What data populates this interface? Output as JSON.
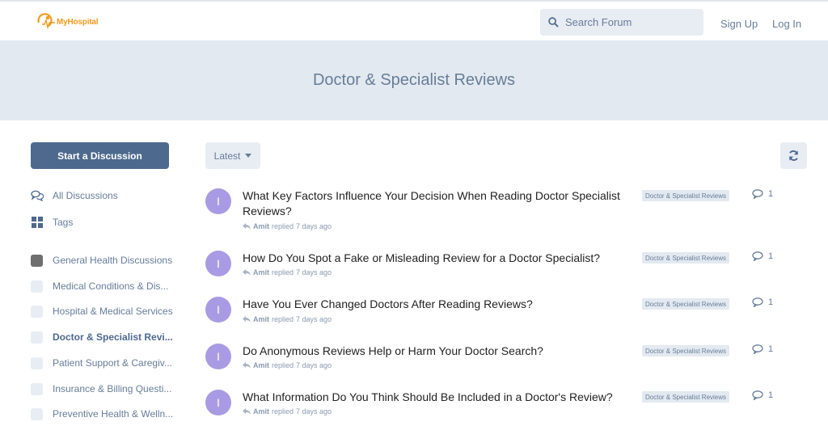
{
  "header": {
    "logo_text": "MyHospital",
    "search_placeholder": "Search Forum",
    "signup_label": "Sign Up",
    "login_label": "Log In"
  },
  "hero": {
    "title": "Doctor & Specialist Reviews"
  },
  "sidebar": {
    "start_label": "Start a Discussion",
    "nav": [
      {
        "label": "All Discussions",
        "icon": "comments-icon"
      },
      {
        "label": "Tags",
        "icon": "tags-grid-icon"
      }
    ],
    "tags": [
      {
        "label": "General Health Discussions"
      },
      {
        "label": "Medical Conditions & Dis..."
      },
      {
        "label": "Hospital & Medical Services"
      },
      {
        "label": "Doctor & Specialist Revi..."
      },
      {
        "label": "Patient Support & Caregiv..."
      },
      {
        "label": "Insurance & Billing Questi..."
      },
      {
        "label": "Preventive Health & Welln..."
      }
    ]
  },
  "toolbar": {
    "sort_label": "Latest"
  },
  "discussions": [
    {
      "avatar": "I",
      "title": "What Key Factors Influence Your Decision When Reading Doctor Specialist Reviews?",
      "user": "Amit",
      "action": "replied",
      "time": "7 days ago",
      "tag": "Doctor & Specialist Reviews",
      "count": "1"
    },
    {
      "avatar": "I",
      "title": "How Do You Spot a Fake or Misleading Review for a Doctor Specialist?",
      "user": "Amit",
      "action": "replied",
      "time": "7 days ago",
      "tag": "Doctor & Specialist Reviews",
      "count": "1"
    },
    {
      "avatar": "I",
      "title": "Have You Ever Changed Doctors After Reading Reviews?",
      "user": "Amit",
      "action": "replied",
      "time": "7 days ago",
      "tag": "Doctor & Specialist Reviews",
      "count": "1"
    },
    {
      "avatar": "I",
      "title": "Do Anonymous Reviews Help or Harm Your Doctor Search?",
      "user": "Amit",
      "action": "replied",
      "time": "7 days ago",
      "tag": "Doctor & Specialist Reviews",
      "count": "1"
    },
    {
      "avatar": "I",
      "title": "What Information Do You Think Should Be Included in a Doctor's Review?",
      "user": "Amit",
      "action": "replied",
      "time": "7 days ago",
      "tag": "Doctor & Specialist Reviews",
      "count": "1"
    }
  ],
  "colors": {
    "primary": "#4d698e",
    "muted": "#667d99",
    "hero_bg": "#e3e9f0",
    "avatar": "#a99be3",
    "logo": "#f29b1d"
  }
}
